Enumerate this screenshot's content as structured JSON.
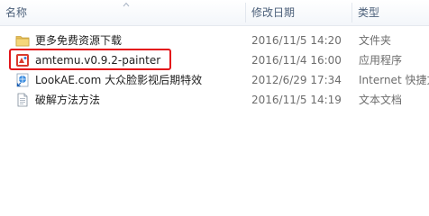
{
  "columns": {
    "name": "名称",
    "date": "修改日期",
    "type": "类型"
  },
  "files": [
    {
      "name": "更多免费资源下载",
      "date": "2016/11/5 14:20",
      "type": "文件夹",
      "icon": "folder-icon"
    },
    {
      "name": "amtemu.v0.9.2-painter",
      "date": "2016/11/4 16:00",
      "type": "应用程序",
      "icon": "application-icon"
    },
    {
      "name": "LookAE.com  大众脸影视后期特效",
      "date": "2012/6/29 17:34",
      "type": "Internet 快捷方式",
      "icon": "internet-shortcut-icon"
    },
    {
      "name": "破解方法方法",
      "date": "2016/11/5 14:19",
      "type": "文本文档",
      "icon": "text-document-icon"
    }
  ],
  "highlight_color": "#e3151a",
  "folder_color": "#e8c05a"
}
